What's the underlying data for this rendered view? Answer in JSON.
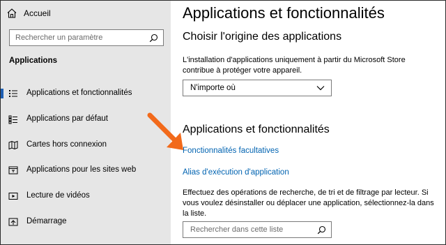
{
  "sidebar": {
    "home_label": "Accueil",
    "search_placeholder": "Rechercher un paramètre",
    "section_title": "Applications",
    "items": [
      {
        "label": "Applications et fonctionnalités",
        "icon": "list-icon",
        "active": true
      },
      {
        "label": "Applications par défaut",
        "icon": "default-apps-icon",
        "active": false
      },
      {
        "label": "Cartes hors connexion",
        "icon": "map-icon",
        "active": false
      },
      {
        "label": "Applications pour les sites web",
        "icon": "website-apps-icon",
        "active": false
      },
      {
        "label": "Lecture de vidéos",
        "icon": "video-icon",
        "active": false
      },
      {
        "label": "Démarrage",
        "icon": "startup-icon",
        "active": false
      }
    ]
  },
  "main": {
    "title": "Applications et fonctionnalités",
    "origin_heading": "Choisir l'origine des applications",
    "origin_description": "L'installation d'applications uniquement à partir du Microsoft Store contribue à protéger votre appareil.",
    "origin_select_value": "N'importe où",
    "apps_heading": "Applications et fonctionnalités",
    "link_optional_features": "Fonctionnalités facultatives",
    "link_exec_alias": "Alias d'exécution d'application",
    "search_description": "Effectuez des opérations de recherche, de tri et de filtrage par lecteur. Si vous voulez désinstaller ou déplacer une application, sélectionnez-la dans la liste.",
    "list_search_placeholder": "Rechercher dans cette liste"
  },
  "colors": {
    "sidebar_bg": "#e6e6e6",
    "accent": "#1e5fb3",
    "link": "#0063b1",
    "annotation_arrow": "#f26a1b"
  }
}
